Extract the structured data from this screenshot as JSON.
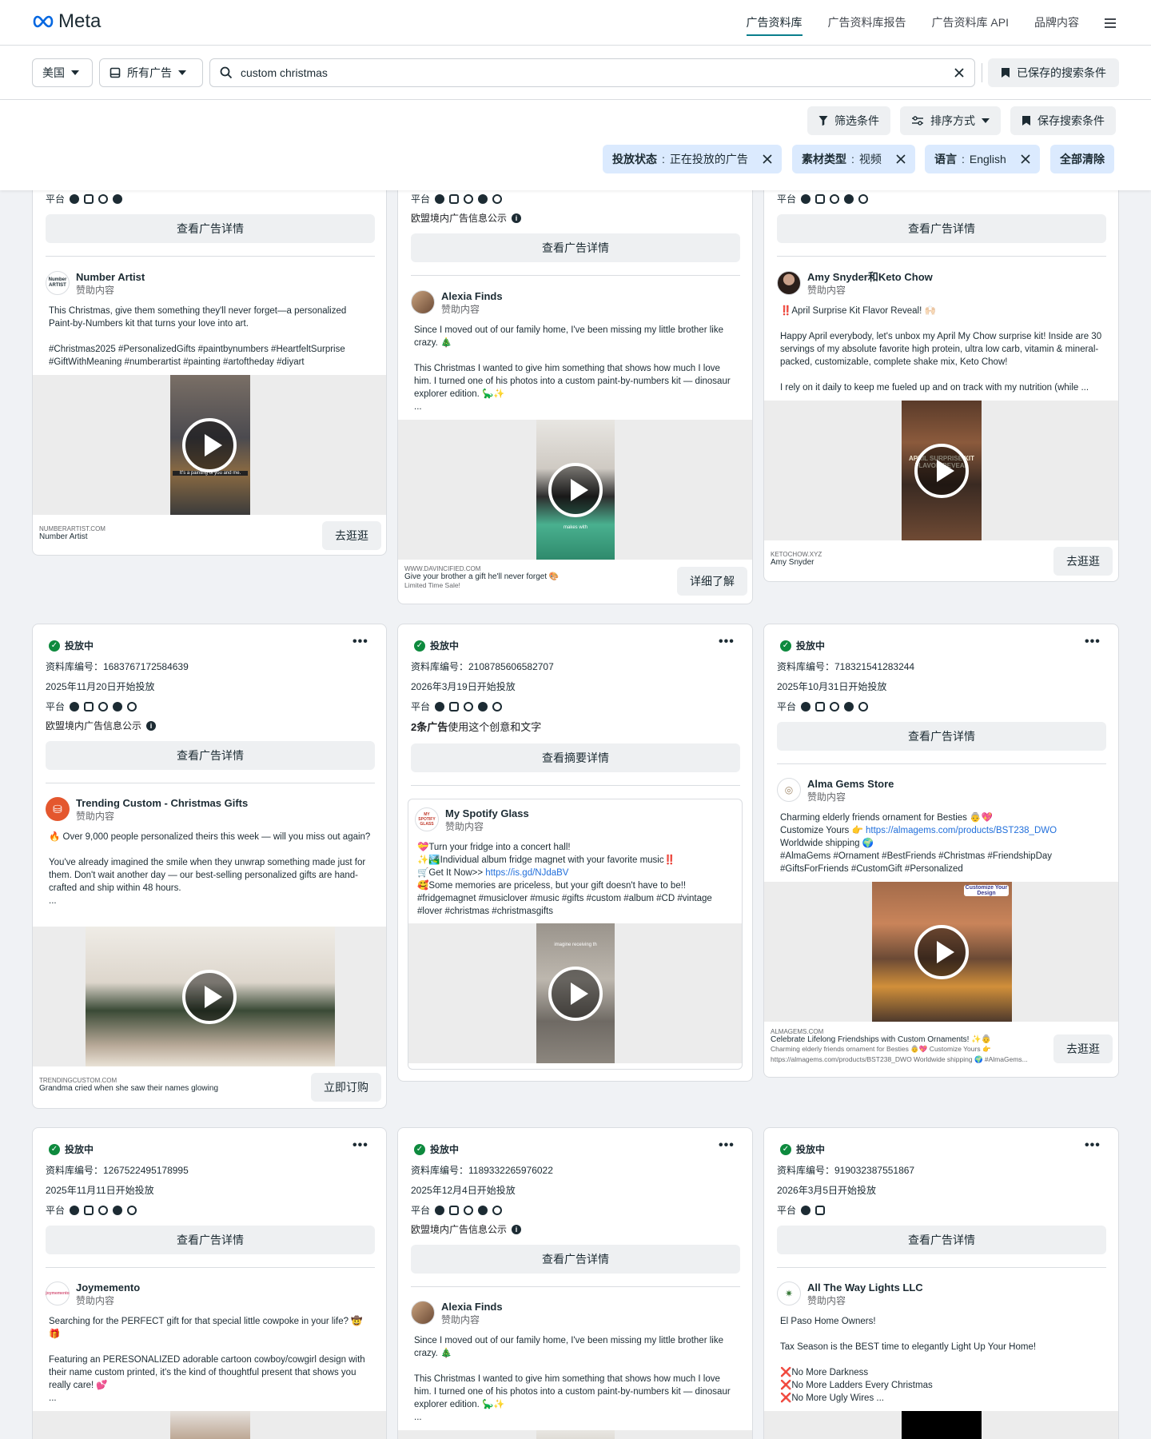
{
  "brand": {
    "name": "Meta"
  },
  "nav": [
    "广告资料库",
    "广告资料库报告",
    "广告资料库 API",
    "品牌内容"
  ],
  "search": {
    "country": "美国",
    "ad_type": "所有广告",
    "query": "custom christmas",
    "saved": "已保存的搜索条件"
  },
  "toolbar": {
    "filter": "筛选条件",
    "sort": "排序方式",
    "save": "保存搜索条件",
    "clear": "全部清除"
  },
  "chips": [
    {
      "label": "投放状态",
      "value": "正在投放的广告"
    },
    {
      "label": "素材类型",
      "value": "视频"
    },
    {
      "label": "语言",
      "value": "English"
    }
  ],
  "labels": {
    "status": "投放中",
    "platform": "平台",
    "eu": "欧盟境内广告信息公示",
    "details": "查看广告详情",
    "summary": "查看摘要详情",
    "sponsored": "赞助内容",
    "creative_count": "2条广告",
    "creative_text": "使用这个创意和文字"
  },
  "cards": {
    "c1": {
      "advertiser": "Number Artist",
      "avatar": "Number ARTIST",
      "body": "This Christmas, give them something they'll never forget—a personalized Paint-by-Numbers kit that turns your love into art.\n\n#Christmas2025 #PersonalizedGifts #paintbynumbers #HeartfeltSurprise #GiftWithMeaning #numberartist #painting #artoftheday #diyart",
      "caption": "It's a painting of you and me.",
      "domain": "NUMBERARTIST.COM",
      "title": "Number Artist",
      "cta": "去逛逛"
    },
    "c2": {
      "advertiser": "Alexia Finds",
      "body": "Since I moved out of our family home, I've been missing my little brother like crazy. 🎄\n\nThis Christmas I wanted to give him something that shows how much I love him. I turned one of his photos into a custom paint-by-numbers kit — dinosaur explorer edition. 🦕✨\n...",
      "caption": "makes with",
      "domain": "WWW.DAVINCIFIED.COM",
      "title": "Give your brother a gift he'll never forget 🎨",
      "sub": "Limited Time Sale!",
      "cta": "详细了解"
    },
    "c3": {
      "advertiser": "Amy Snyder和Keto Chow",
      "body": "‼️April Surprise Kit Flavor Reveal! 🙌🏻\n\nHappy April everybody, let's unbox my April My Chow surprise kit! Inside are 30 servings of my absolute favorite high protein, ultra low carb, vitamin & mineral-packed, customizable, complete shake mix, Keto Chow!\n\nI rely on it daily to keep me fueled up and on track with my nutrition (while ...",
      "caption": "APRIL SURPRISE KIT FLAVOR REVEAL",
      "domain": "KETOCHOW.XYZ",
      "title": "Amy Snyder",
      "cta": "去逛逛"
    },
    "c4": {
      "id": "资料库编号：1683767172584639",
      "date": "2025年11月20日开始投放",
      "advertiser": "Trending Custom - Christmas Gifts",
      "body": "🔥 Over 9,000 people personalized theirs this week — will you miss out again?\n\nYou've already imagined the smile when they unwrap something made just for them. Don't wait another day — our best-selling personalized gifts are hand-crafted and ship within 48 hours.\n...",
      "domain": "TRENDINGCUSTOM.COM",
      "title": "Grandma cried when she saw their names glowing",
      "cta": "立即订购"
    },
    "c5": {
      "id": "资料库编号：2108785606582707",
      "date": "2026年3月19日开始投放",
      "advertiser": "My Spotify Glass",
      "avatar": "MY SPOTIFY GLASS",
      "body_pre": "💝Turn your fridge into a concert hall!\n✨🏞️Individual album fridge magnet with your favorite music‼️\n🛒Get It Now>> ",
      "link": "https://is.gd/NJdaBV",
      "body_post": "\n🥰Some memories are priceless, but your gift doesn't have to be!!\n#fridgemagnet #musiclover #music #gifts #custom  #album #CD #vintage #lover #christmas #christmasgifts",
      "caption": "imagine receiving th"
    },
    "c6": {
      "id": "资料库编号：718321541283244",
      "date": "2025年10月31日开始投放",
      "advertiser": "Alma Gems Store",
      "body_pre": "Charming elderly friends ornament for Besties 👵💖\nCustomize Yours 👉 ",
      "link": "https://almagems.com/products/BST238_DWO",
      "body_post": "\nWorldwide shipping 🌍\n#AlmaGems #Ornament #BestFriends #Christmas #FriendshipDay #GiftsForFriends #CustomGift #Personalized",
      "caption": "Customize Your Design",
      "domain": "ALMAGEMS.COM",
      "title": "Celebrate Lifelong Friendships with Custom Ornaments! ✨👵",
      "sub": "Charming elderly friends ornament for Besties 👵💖 Customize Yours 👉 https://almagems.com/products/BST238_DWO Worldwide shipping 🌍 #AlmaGems...",
      "cta": "去逛逛"
    },
    "c7": {
      "id": "资料库编号：1267522495178995",
      "date": "2025年11月11日开始投放",
      "advertiser": "Joymemento",
      "avatar": "joymemento",
      "body": "Searching for the PERFECT gift for that special little cowpoke in your life? 🤠🎁\n\nFeaturing an PERESONALIZED adorable cartoon cowboy/cowgirl design with their name custom printed, it's the kind of thoughtful present that shows you really care! 💕\n..."
    },
    "c8": {
      "id": "资料库编号：1189332265976022",
      "date": "2025年12月4日开始投放",
      "advertiser": "Alexia Finds",
      "body": "Since I moved out of our family home, I've been missing my little brother like crazy. 🎄\n\nThis Christmas I wanted to give him something that shows how much I love him. I turned one of his photos into a custom paint-by-numbers kit — dinosaur explorer edition. 🦕✨\n..."
    },
    "c9": {
      "id": "资料库编号：919032387551867",
      "date": "2026年3月5日开始投放",
      "advertiser": "All The Way Lights LLC",
      "body": "El Paso Home Owners!\n\nTax Season is the BEST time to elegantly Light Up Your Home!\n\n❌No More Darkness\n❌No More Ladders Every Christmas\n❌No More Ugly Wires ..."
    }
  }
}
